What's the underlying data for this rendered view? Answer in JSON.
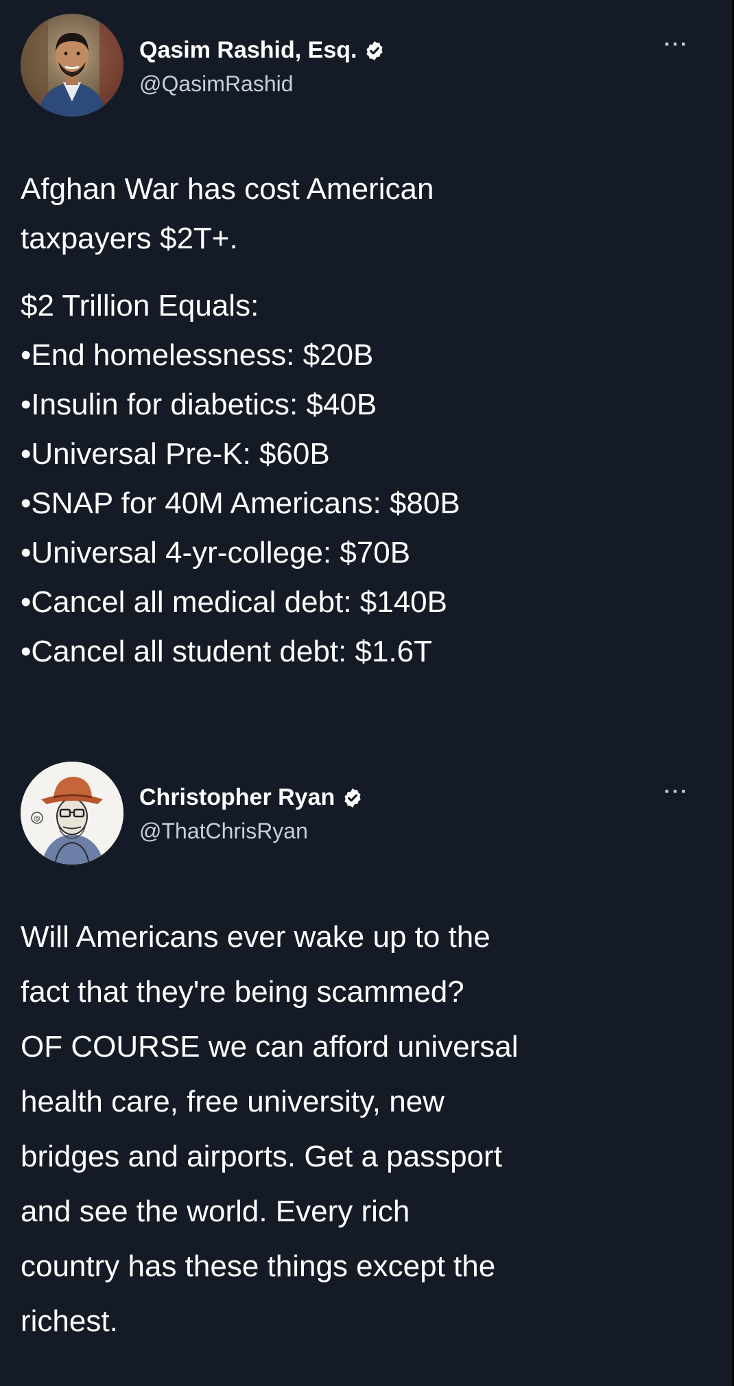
{
  "tweets": [
    {
      "author": {
        "name": "Qasim Rashid, Esq.",
        "handle": "@QasimRashid",
        "verified": true
      },
      "more_label": "···",
      "paragraphs": [
        [
          "Afghan War has cost American",
          "taxpayers $2T+."
        ],
        [
          "$2 Trillion Equals:",
          "•End homelessness: $20B",
          "•Insulin for diabetics: $40B",
          "•Universal Pre-K: $60B",
          "•SNAP for 40M Americans: $80B",
          "•Universal 4-yr-college: $70B",
          "•Cancel all medical debt: $140B",
          "•Cancel all student debt: $1.6T"
        ]
      ]
    },
    {
      "author": {
        "name": "Christopher Ryan",
        "handle": "@ThatChrisRyan",
        "verified": true
      },
      "more_label": "···",
      "paragraphs": [
        [
          "Will Americans ever wake up to the",
          "fact that they're being scammed?",
          "OF COURSE we can afford universal",
          "health care, free university, new",
          "bridges and airports. Get a passport",
          "and see the world. Every rich",
          "country has these things except the",
          "richest."
        ]
      ]
    }
  ],
  "colors": {
    "background": "#151b26",
    "verified_badge": "#ffffff",
    "handle_text": "#c8ced6"
  },
  "icons": [
    "verified-badge-icon",
    "more-options-icon"
  ]
}
